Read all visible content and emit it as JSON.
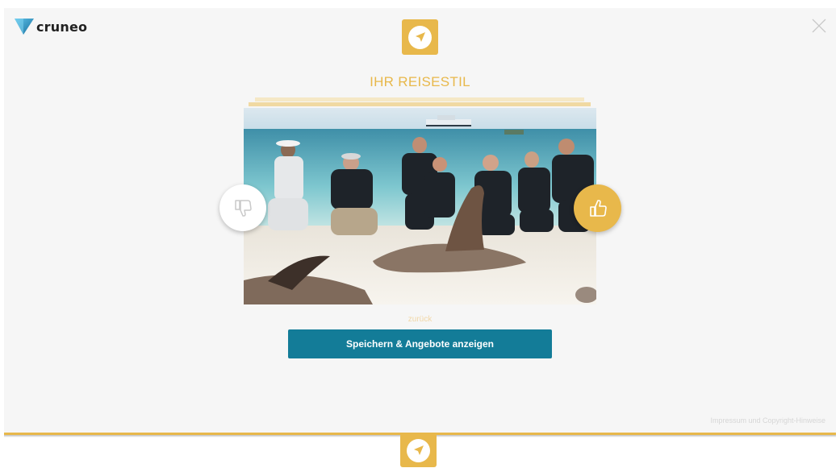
{
  "brand": {
    "name": "cruneo"
  },
  "colors": {
    "accent": "#e8b84b",
    "button": "#137c98",
    "panel": "#f6f6f6"
  },
  "icons": {
    "logo": "cruneo-triangle-logo",
    "close": "close-icon",
    "compass": "compass-icon",
    "dislike": "thumbs-down-icon",
    "like": "thumbs-up-icon"
  },
  "quiz": {
    "title": "IHR REISESTIL",
    "image_subject": "group-with-sea-lions-on-beach",
    "back_label": "zurück",
    "save_button_label": "Speichern & Angebote anzeigen"
  },
  "footer": {
    "legal_link": "Impressum und Copyright-Hinweise"
  }
}
